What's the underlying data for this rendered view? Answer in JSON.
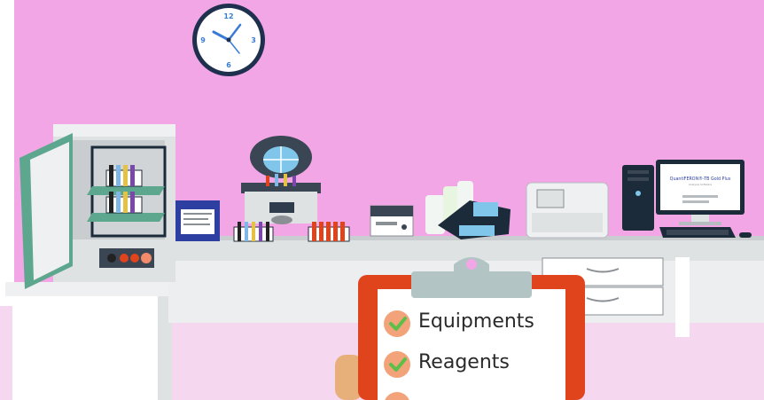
{
  "clock": {
    "n12": "12",
    "n3": "3",
    "n6": "6",
    "n9": "9"
  },
  "monitor": {
    "title": "QuantiFERON®-TB Gold Plus",
    "subtitle": "Analysis Software"
  },
  "checklist": {
    "items": [
      {
        "label": "Equipments"
      },
      {
        "label": "Reagents"
      }
    ]
  },
  "colors": {
    "wall": "#f3a6e6",
    "floor": "#f6d7f0",
    "desk": "#dfe2e3",
    "clipboard": "#e0441c",
    "check": "#f2a37a",
    "check_mark": "#5cbf4a",
    "incubator_door": "#5ea78f"
  }
}
